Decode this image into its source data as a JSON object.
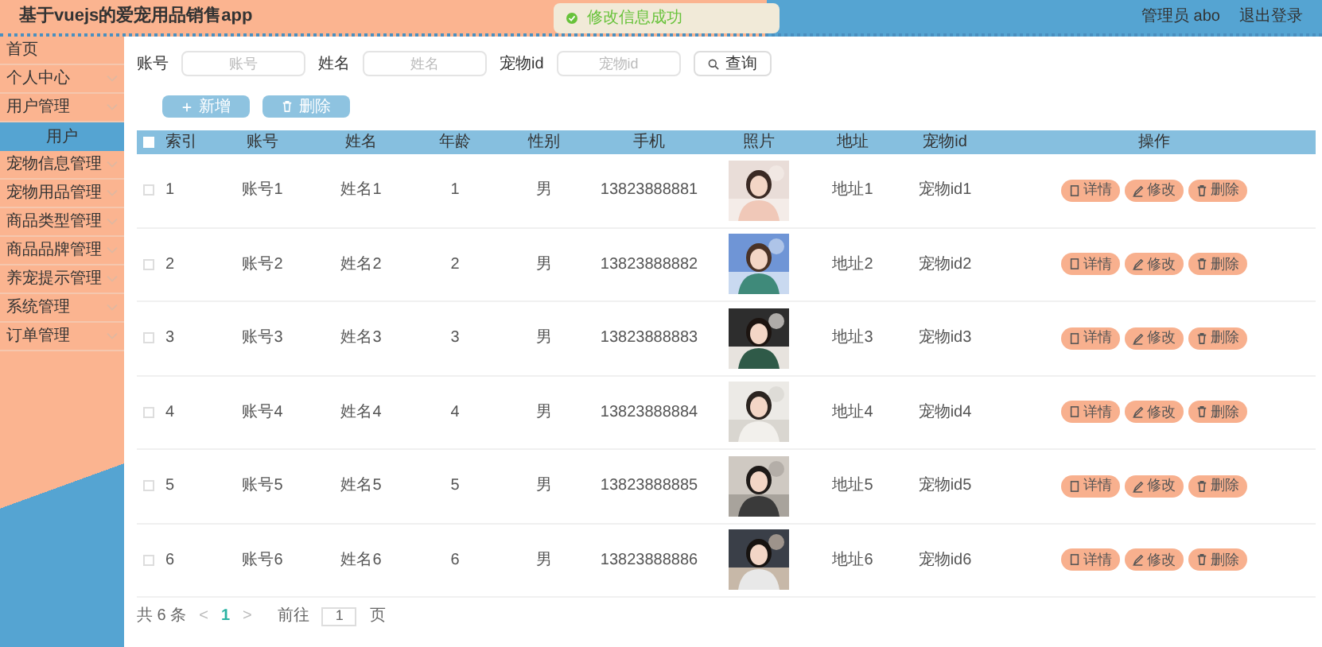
{
  "header": {
    "title": "基于vuejs的爱宠用品销售app",
    "user": "管理员 abo",
    "logout": "退出登录"
  },
  "toast": {
    "message": "修改信息成功"
  },
  "sidebar": {
    "items": [
      {
        "label": "首页",
        "selected": false,
        "expandable": false
      },
      {
        "label": "个人中心",
        "selected": false,
        "expandable": true
      },
      {
        "label": "用户管理",
        "selected": false,
        "expandable": true,
        "children": [
          {
            "label": "用户",
            "selected": true
          }
        ]
      },
      {
        "label": "宠物信息管理",
        "selected": false,
        "expandable": true
      },
      {
        "label": "宠物用品管理",
        "selected": false,
        "expandable": true
      },
      {
        "label": "商品类型管理",
        "selected": false,
        "expandable": true
      },
      {
        "label": "商品品牌管理",
        "selected": false,
        "expandable": true
      },
      {
        "label": "养宠提示管理",
        "selected": false,
        "expandable": true
      },
      {
        "label": "系统管理",
        "selected": false,
        "expandable": true
      },
      {
        "label": "订单管理",
        "selected": false,
        "expandable": true
      }
    ]
  },
  "search": {
    "fields": [
      {
        "label": "账号",
        "placeholder": "账号"
      },
      {
        "label": "姓名",
        "placeholder": "姓名"
      },
      {
        "label": "宠物id",
        "placeholder": "宠物id"
      }
    ],
    "button": "查询"
  },
  "actions": [
    {
      "label": "新增",
      "kind": "add"
    },
    {
      "label": "删除",
      "kind": "delete"
    }
  ],
  "table": {
    "select_all": {
      "checked": false
    },
    "columns": [
      "索引",
      "账号",
      "姓名",
      "年龄",
      "性别",
      "手机",
      "照片",
      "地址",
      "宠物id",
      "操作"
    ],
    "rows": [
      {
        "checked": false,
        "cells": [
          "1",
          "账号1",
          "姓名1",
          "1",
          "男",
          "13823888881"
        ],
        "address": "地址1",
        "pet_id": "宠物id1",
        "buttons": [
          {
            "label": "详情",
            "kind": "detail"
          },
          {
            "label": "修改",
            "kind": "edit"
          },
          {
            "label": "删除",
            "kind": "delete"
          }
        ]
      },
      {
        "checked": false,
        "cells": [
          "2",
          "账号2",
          "姓名2",
          "2",
          "男",
          "13823888882"
        ],
        "address": "地址2",
        "pet_id": "宠物id2",
        "buttons": [
          {
            "label": "详情",
            "kind": "detail"
          },
          {
            "label": "修改",
            "kind": "edit"
          },
          {
            "label": "删除",
            "kind": "delete"
          }
        ]
      },
      {
        "checked": false,
        "cells": [
          "3",
          "账号3",
          "姓名3",
          "3",
          "男",
          "13823888883"
        ],
        "address": "地址3",
        "pet_id": "宠物id3",
        "buttons": [
          {
            "label": "详情",
            "kind": "detail"
          },
          {
            "label": "修改",
            "kind": "edit"
          },
          {
            "label": "删除",
            "kind": "delete"
          }
        ]
      },
      {
        "checked": false,
        "cells": [
          "4",
          "账号4",
          "姓名4",
          "4",
          "男",
          "13823888884"
        ],
        "address": "地址4",
        "pet_id": "宠物id4",
        "buttons": [
          {
            "label": "详情",
            "kind": "detail"
          },
          {
            "label": "修改",
            "kind": "edit"
          },
          {
            "label": "删除",
            "kind": "delete"
          }
        ]
      },
      {
        "checked": false,
        "cells": [
          "5",
          "账号5",
          "姓名5",
          "5",
          "男",
          "13823888885"
        ],
        "address": "地址5",
        "pet_id": "宠物id5",
        "buttons": [
          {
            "label": "详情",
            "kind": "detail"
          },
          {
            "label": "修改",
            "kind": "edit"
          },
          {
            "label": "删除",
            "kind": "delete"
          }
        ]
      },
      {
        "checked": false,
        "cells": [
          "6",
          "账号6",
          "姓名6",
          "6",
          "男",
          "13823888886"
        ],
        "address": "地址6",
        "pet_id": "宠物id6",
        "buttons": [
          {
            "label": "详情",
            "kind": "detail"
          },
          {
            "label": "修改",
            "kind": "edit"
          },
          {
            "label": "删除",
            "kind": "delete"
          }
        ]
      }
    ]
  },
  "pagination": {
    "total": "共 6 条",
    "prev": "<",
    "pages": [
      {
        "label": "1",
        "selected": true
      }
    ],
    "next": ">",
    "goto_label": "前往",
    "goto_value": "1",
    "goto_suffix": "页"
  }
}
